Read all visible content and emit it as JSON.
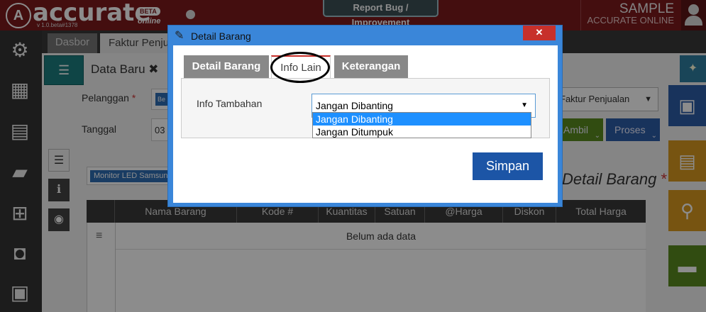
{
  "app": {
    "logo_letter": "A",
    "logo_name": "accurate",
    "beta": "BETA",
    "online": "online",
    "version": "v 1.0.beta#1378",
    "report_button": "Report Bug / Improvement",
    "company_name": "SAMPLE",
    "company_sub": "ACCURATE ONLINE"
  },
  "tabs": [
    {
      "label": "Dasbor"
    },
    {
      "label": "Faktur Penjualan"
    }
  ],
  "form": {
    "title": "Data Baru",
    "close": "✖",
    "pelanggan_label": "Pelanggan",
    "required": "*",
    "pelanggan_chip": "Be",
    "tanggal_label": "Tanggal",
    "tanggal_value": "03",
    "mode_select": "Faktur Penjualan",
    "ambil_label": "Ambil",
    "proses_label": "Proses",
    "barang_chip": "Monitor LED Samsung",
    "detail_title": "Detail Barang"
  },
  "table": {
    "headers": [
      "Nama Barang",
      "Kode #",
      "Kuantitas",
      "Satuan",
      "@Harga",
      "Diskon",
      "Total Harga"
    ],
    "empty": "Belum ada data"
  },
  "modal": {
    "title": "Detail Barang",
    "close": "✕",
    "tabs": [
      "Detail Barang",
      "Info Lain",
      "Keterangan"
    ],
    "active_tab": "Info Lain",
    "field_label": "Info Tambahan",
    "select_value": "Jangan Dibanting",
    "options": [
      "Jangan Dibanting",
      "Jangan Ditumpuk"
    ],
    "save_button": "Simpan"
  },
  "colors": {
    "topbar": "#7d1a1d",
    "modal_frame": "#3a86d9",
    "primary_button": "#1c55a6",
    "option_highlight": "#1e90ff"
  }
}
